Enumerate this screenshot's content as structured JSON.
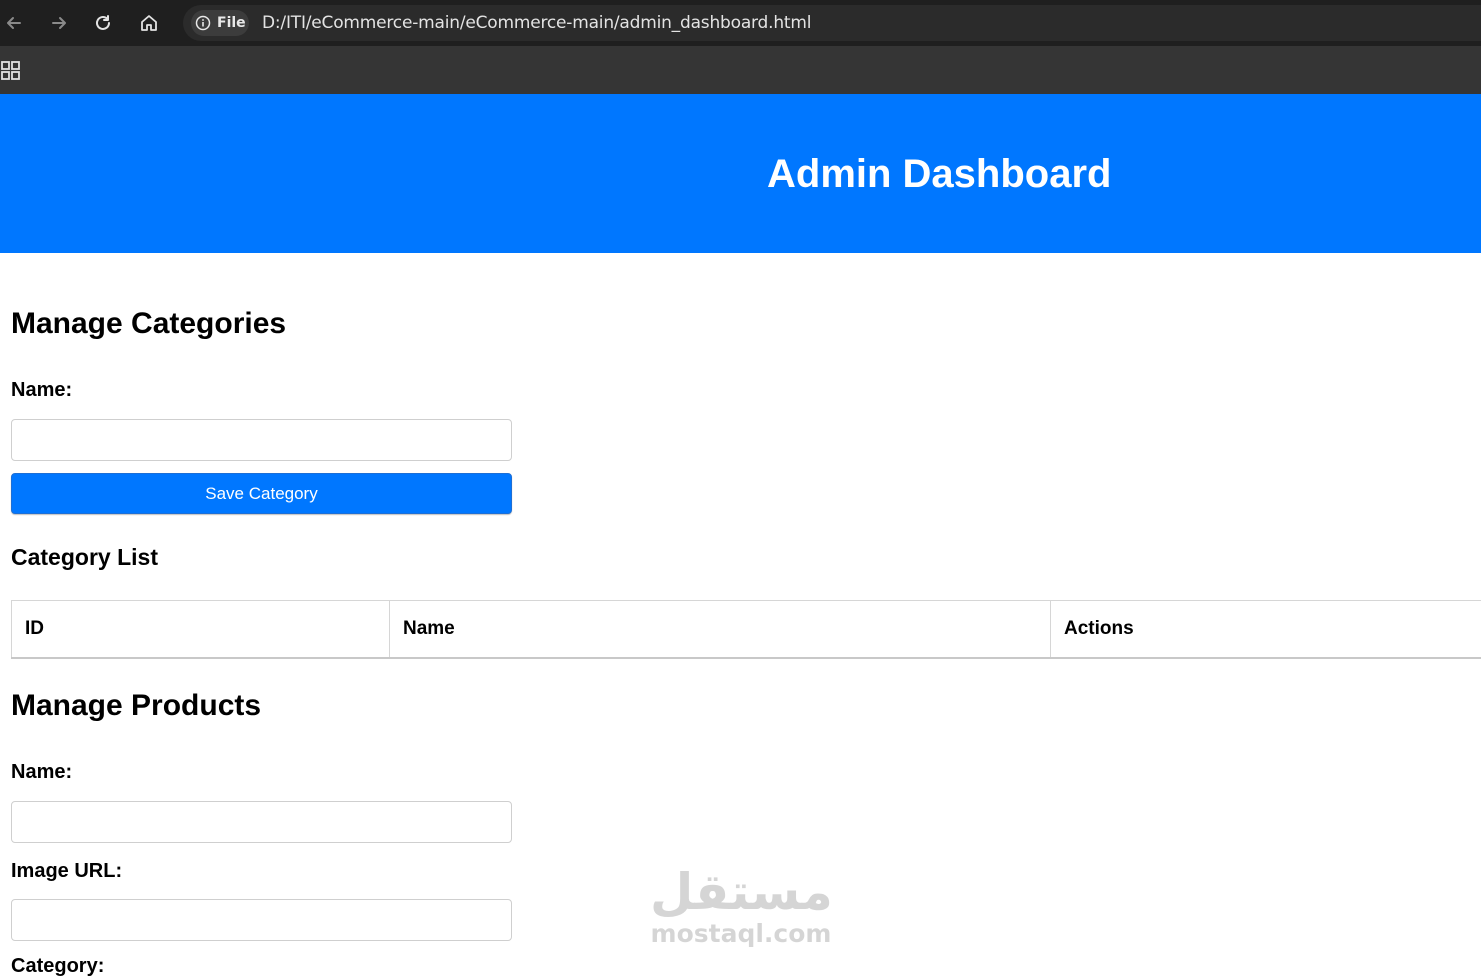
{
  "browser": {
    "url_chip_label": "File",
    "url": "D:/ITI/eCommerce-main/eCommerce-main/admin_dashboard.html",
    "icons": [
      "back-arrow-icon",
      "forward-arrow-icon",
      "reload-icon",
      "home-icon",
      "info-icon",
      "apps-grid-icon"
    ]
  },
  "header": {
    "title": "Admin Dashboard",
    "background_color": "#0077ff"
  },
  "categories": {
    "section_title": "Manage Categories",
    "name_label": "Name:",
    "name_value": "",
    "save_button_label": "Save Category",
    "list_title": "Category List",
    "table_columns": [
      "ID",
      "Name",
      "Actions"
    ],
    "rows": []
  },
  "products": {
    "section_title": "Manage Products",
    "name_label": "Name:",
    "name_value": "",
    "image_url_label": "Image URL:",
    "image_url_value": "",
    "category_label": "Category:"
  },
  "watermark": {
    "arabic": "مستقل",
    "latin": "mostaql.com"
  }
}
